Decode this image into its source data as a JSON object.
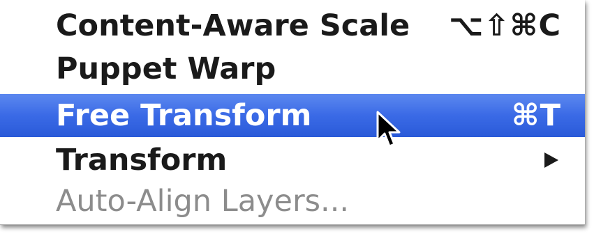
{
  "menu": {
    "items": [
      {
        "label": "Content-Aware Scale",
        "shortcut": "⌥⇧⌘C",
        "state": "normal"
      },
      {
        "label": "Puppet Warp",
        "shortcut": "",
        "state": "normal"
      },
      {
        "label": "Free Transform",
        "shortcut": "⌘T",
        "state": "highlighted"
      },
      {
        "label": "Transform",
        "shortcut": "",
        "state": "normal",
        "has_submenu": true,
        "submenu_icon": "submenu-arrow-icon"
      },
      {
        "label": "Auto-Align Layers...",
        "shortcut": "",
        "state": "disabled"
      }
    ]
  },
  "colors": {
    "highlight": "#3a6ae6",
    "text": "#1a1a1a",
    "disabled_text": "#8c8c8c"
  },
  "cursor": {
    "icon": "arrow-pointer-icon"
  }
}
